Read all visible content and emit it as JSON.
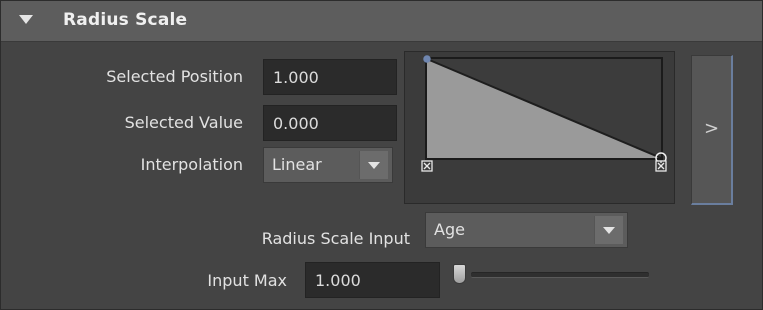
{
  "section": {
    "title": "Radius Scale",
    "expanded": true
  },
  "fields": {
    "selected_position": {
      "label": "Selected Position",
      "value": "1.000"
    },
    "selected_value": {
      "label": "Selected Value",
      "value": "0.000"
    },
    "interpolation": {
      "label": "Interpolation",
      "value": "Linear"
    },
    "radius_scale_input": {
      "label": "Radius Scale Input",
      "value": "Age"
    },
    "input_max": {
      "label": "Input Max",
      "value": "1.000",
      "slider_fraction": 0.0
    }
  },
  "ramp": {
    "points": [
      {
        "position": 0.0,
        "value": 1.0
      },
      {
        "position": 1.0,
        "value": 0.0,
        "selected": true
      }
    ],
    "interpolation": "linear",
    "colors": {
      "fill": "#9a9a9a",
      "background": "#3c3c3c",
      "line": "#1e1e1e",
      "selected_marker": "#f2f2f2"
    }
  },
  "expand_button": {
    "label": ">"
  },
  "colors": {
    "panel_bg": "#444444",
    "header_bg": "#5d5d5d",
    "field_bg": "#2b2b2b",
    "text": "#e2e2e2",
    "accent": "#6a7e9e"
  }
}
